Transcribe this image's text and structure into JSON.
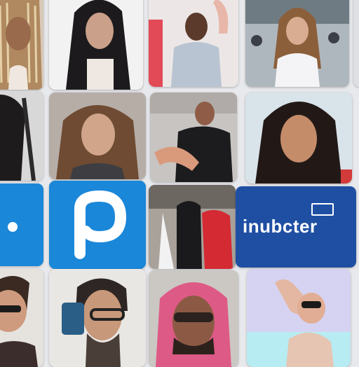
{
  "grid": {
    "tiles": [
      {
        "name": "photo-woman-braids",
        "kind": "photo"
      },
      {
        "name": "photo-woman-dark-hair",
        "kind": "photo"
      },
      {
        "name": "photo-man-mask",
        "kind": "photo"
      },
      {
        "name": "photo-woman-crowd",
        "kind": "photo"
      },
      {
        "name": "photo-woman-long-hair",
        "kind": "photo"
      },
      {
        "name": "photo-man-gesturing",
        "kind": "photo"
      },
      {
        "name": "photo-woman-portrait",
        "kind": "photo"
      },
      {
        "name": "photo-group-street",
        "kind": "photo"
      },
      {
        "name": "photo-man-glasses-phone",
        "kind": "photo"
      },
      {
        "name": "photo-man-pink-hood",
        "kind": "photo"
      },
      {
        "name": "photo-figure-pastel",
        "kind": "photo"
      }
    ],
    "apps": {
      "dot_app": {
        "icon": "dot-icon",
        "color": "#1a87d9"
      },
      "p_app": {
        "icon": "p-logo-icon",
        "color": "#1a87d9"
      },
      "brand_app": {
        "label": "inubcter",
        "color": "#1f4fa3",
        "icon": "rectangle-mark-icon"
      }
    }
  }
}
